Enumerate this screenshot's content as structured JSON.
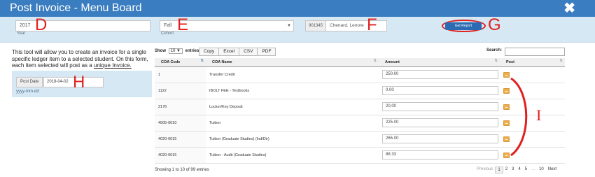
{
  "window": {
    "title": "Post Invoice - Menu Board",
    "close_glyph": "✖"
  },
  "filters": {
    "year_value": "2017",
    "year_label": "Year",
    "cohort_value": "Fall",
    "cohort_label": "Cohort",
    "student_id": "901345",
    "student_name": "Chenard, Lenore",
    "get_report_label": "Get Report"
  },
  "annotations": {
    "d": "D",
    "e": "E",
    "f": "F",
    "g": "G",
    "h": "H",
    "i": "I"
  },
  "info": {
    "text_before": "This tool will allow you to create an invoice for a single specific ledger item to a selected student. On this form, each item selected will post as a ",
    "text_link": "unique Invoice."
  },
  "post_date": {
    "label": "Post Date",
    "value": "2018-04-02",
    "hint": "yyyy-mm-dd"
  },
  "table_controls": {
    "show_label": "Show",
    "show_value": "10",
    "entries_label": "entries",
    "buttons": [
      "Copy",
      "Excel",
      "CSV",
      "PDF"
    ],
    "search_label": "Search:"
  },
  "table": {
    "headers": [
      "COA Code",
      "COA Name",
      "Amount",
      "Post"
    ],
    "rows": [
      {
        "code": "1",
        "name": "Transfer Credit",
        "amount": "250.00"
      },
      {
        "code": "1122",
        "name": "IBOLT FEE - Textbooks",
        "amount": "0.00"
      },
      {
        "code": "2176",
        "name": "Locker/Key Deposit",
        "amount": "20.00"
      },
      {
        "code": "4005-0010",
        "name": "Tuition",
        "amount": "225.00"
      },
      {
        "code": "4020-0015",
        "name": "Tuition (Graduate Studies) (Ind/Dir)",
        "amount": "265.00"
      },
      {
        "code": "4020-0015",
        "name": "Tuition - Audit (Graduate Studies)",
        "amount": "88.33"
      }
    ]
  },
  "footer": {
    "info": "Showing 1 to 10 of 99 entries",
    "previous": "Previous",
    "pages": [
      "1",
      "2",
      "3",
      "4",
      "5"
    ],
    "ellipsis": "...",
    "last_page": "10",
    "next": "Next"
  },
  "colors": {
    "header_blue": "#3a7dc0",
    "filter_bg": "#d5e8f4",
    "annotation_red": "#e0201f",
    "post_orange": "#f0ad4e"
  }
}
